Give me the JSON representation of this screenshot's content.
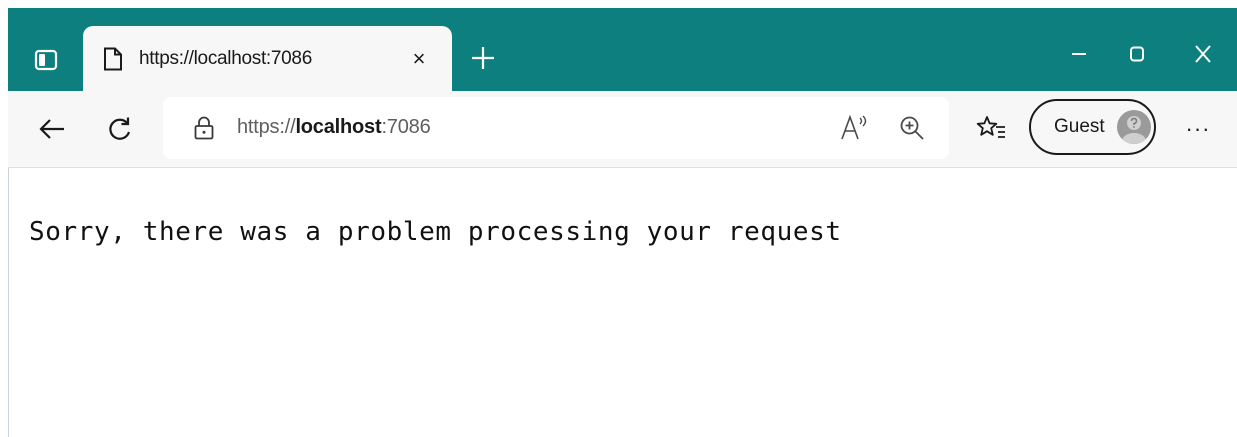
{
  "colors": {
    "titlebar": "#0e7f7f",
    "toolbar": "#f7f7f7",
    "text": "#1a1a1a"
  },
  "tab": {
    "title": "https://localhost:7086",
    "close_glyph": "×",
    "icon": "page-icon"
  },
  "new_tab": {
    "glyph": "+"
  },
  "window_controls": {
    "minimize_glyph": "–",
    "maximize_glyph": "▢",
    "close_glyph": "X"
  },
  "toolbar": {
    "back_icon": "back-arrow-icon",
    "refresh_icon": "refresh-icon",
    "more_glyph": "···"
  },
  "address": {
    "prefix": "https://",
    "host": "localhost",
    "port": ":7086",
    "icons": [
      "info-lock-icon",
      "read-aloud-icon",
      "zoom-in-icon",
      "favorites-icon"
    ]
  },
  "profile": {
    "label": "Guest"
  },
  "page": {
    "message": "Sorry, there was a problem processing your request"
  }
}
